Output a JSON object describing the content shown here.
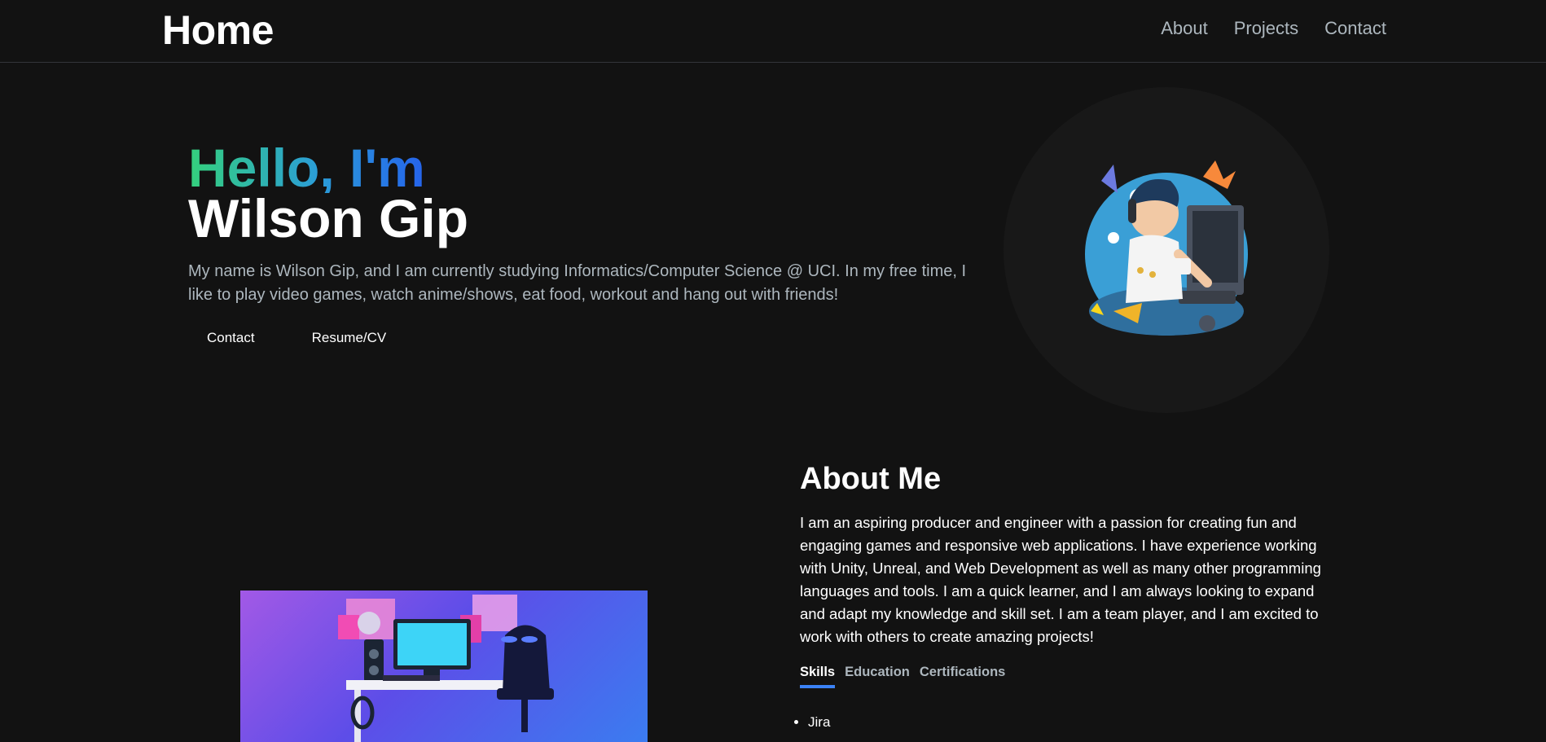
{
  "nav": {
    "logo": "Home",
    "links": [
      "About",
      "Projects",
      "Contact"
    ]
  },
  "hero": {
    "greeting": "Hello, I'm",
    "name": "Wilson Gip",
    "bio": "My name is Wilson Gip, and I am currently studying Informatics/Computer Science @ UCI. In my free time, I like to play video games, watch anime/shows, eat food, workout and hang out with friends!",
    "buttons": {
      "contact": "Contact",
      "resume": "Resume/CV"
    },
    "avatar_icon": "gamer-avatar-illustration"
  },
  "about": {
    "title": "About Me",
    "body": "I am an aspiring producer and engineer with a passion for creating fun and engaging games and responsive web applications. I have experience working with Unity, Unreal, and Web Development as well as many other programming languages and tools. I am a quick learner, and I am always looking to expand and adapt my knowledge and skill set. I am a team player, and I am excited to work with others to create amazing projects!",
    "tabs": [
      {
        "label": "Skills",
        "active": true
      },
      {
        "label": "Education",
        "active": false
      },
      {
        "label": "Certifications",
        "active": false
      }
    ],
    "skills": [
      "Jira"
    ],
    "image_icon": "gaming-setup-illustration"
  },
  "colors": {
    "background": "#121212",
    "accent": "#3b82f6",
    "gradient_start": "#34d07c",
    "gradient_end": "#2563eb",
    "muted_text": "#adb7be"
  }
}
